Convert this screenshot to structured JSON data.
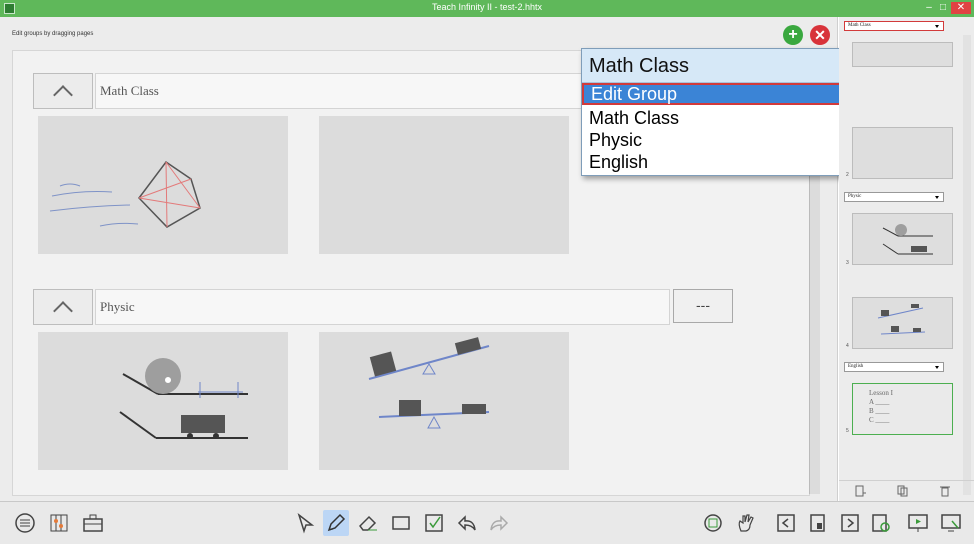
{
  "window": {
    "title": "Teach Infinity II - test-2.hhtx",
    "minimize": "–",
    "maximize": "□",
    "close": "✕"
  },
  "main": {
    "hint": "Edit groups by dragging pages",
    "add_button": "+",
    "delete_button": "✕",
    "groups": [
      {
        "label": "Math Class"
      },
      {
        "label": "Physic",
        "more_label": "---"
      }
    ]
  },
  "group_dropdown": {
    "selected": "Math Class",
    "options": [
      "Edit Group",
      "Math Class",
      "Physic",
      "English"
    ]
  },
  "sidebar": {
    "top_select": "Math Class",
    "groups": [
      {
        "select": "Physic",
        "page_numbers": [
          "3",
          "4"
        ]
      },
      {
        "select": "English",
        "page_numbers": [
          "5"
        ]
      }
    ],
    "partial_page_number": "2",
    "lesson_thumb_text": [
      "Lesson I",
      "A ____",
      "B ____",
      "C ____"
    ]
  },
  "colors": {
    "titlebar": "#5fb85a",
    "accent_selection": "#3b84d6",
    "add_green": "#3aa83f",
    "delete_red": "#d8333a"
  },
  "toolbar": {
    "left": [
      "menu-icon",
      "abacus-icon",
      "toolbox-icon"
    ],
    "center": [
      "select-arrow-icon",
      "pen-icon",
      "eraser-icon",
      "rectangle-icon",
      "checkmark-icon",
      "undo-icon",
      "redo-icon"
    ],
    "right": [
      "zoom-icon",
      "hand-icon",
      "prev-page-icon",
      "pages-icon",
      "next-page-icon",
      "page-settings-icon",
      "presentation-icon",
      "screen-icon"
    ]
  }
}
